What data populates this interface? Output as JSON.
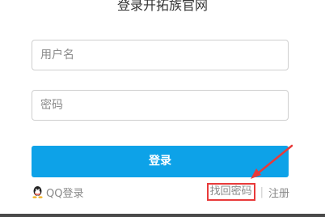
{
  "page": {
    "title": "登录开拓族官网"
  },
  "form": {
    "username_placeholder": "用户名",
    "password_placeholder": "密码",
    "login_label": "登录"
  },
  "footer": {
    "qq_login_label": "QQ登录",
    "forgot_password_label": "找回密码",
    "separator": "|",
    "register_label": "注册"
  },
  "icons": {
    "qq": "qq-penguin-icon",
    "annotation": "red-arrow-icon"
  },
  "colors": {
    "accent": "#0da2e8",
    "highlight": "#e83a3a",
    "muted_text": "#888888"
  }
}
